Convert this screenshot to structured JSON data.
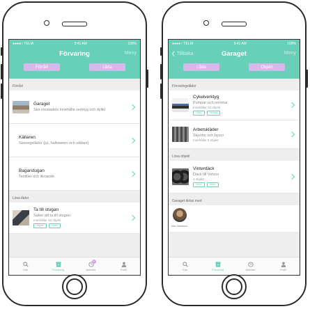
{
  "left": {
    "status": {
      "carrier": "●●●●○ TELIA",
      "time": "9:41 AM",
      "battery": "100%"
    },
    "title": "Förvaring",
    "menu": "Meny",
    "segments": [
      "Förråd",
      "Låda"
    ],
    "section1": "Förråd",
    "items": [
      {
        "name": "Garaget",
        "desc": "Ska mestadels innehålla verktyg och dylikt"
      },
      {
        "name": "Källaren",
        "desc": "Säsongslådor (jul, halloween och sådant)"
      },
      {
        "name": "Bagarstugan",
        "desc": "Textilier och liknande"
      }
    ],
    "section2": "Lösa lådor",
    "box": {
      "name": "Ta till stugan",
      "desc": "Saker att ta till stugan",
      "count": "Innehåller 16 objekt",
      "tags": [
        "Jägare",
        "Vinter"
      ]
    },
    "tabs": [
      "Sök",
      "Förvaring",
      "Aktivitet",
      "Profil"
    ],
    "badge": "3"
  },
  "right": {
    "status": {
      "carrier": "●●●●○ TELIA",
      "time": "9:41 AM",
      "battery": "100%"
    },
    "back": "Tillbaka",
    "title": "Garaget",
    "menu": "Meny",
    "segments": [
      "Låda",
      "Objekt"
    ],
    "section1": "Förvaringslådor",
    "boxes": [
      {
        "name": "Cykelverktyg",
        "desc": "Pumpar och remmar",
        "count": "Innehåller 10 objekt",
        "tags": [
          "Cykel",
          "Verktyg"
        ]
      },
      {
        "name": "Arbetskläder",
        "desc": "Skjortor och byxor",
        "count": "Innehåller 5 objekt",
        "tags": []
      }
    ],
    "section2": "Lösa objekt",
    "object": {
      "name": "Vinterdäck",
      "desc": "Däck till Volvon",
      "count": "4 objekt",
      "tags": [
        "Volvo",
        "Vinter"
      ]
    },
    "section3": "Garaget delas med",
    "shared_user": "Mac Svensson",
    "tabs": [
      "Sök",
      "Förvaring",
      "Aktivitet",
      "Profil"
    ]
  },
  "colors": {
    "accent": "#68cfb8",
    "segment": "#d6b8eb",
    "badge": "#c9a6ea"
  },
  "icons": [
    "search-icon",
    "box-icon",
    "clock-icon",
    "person-icon",
    "chevron-right-icon",
    "chevron-left-icon"
  ]
}
